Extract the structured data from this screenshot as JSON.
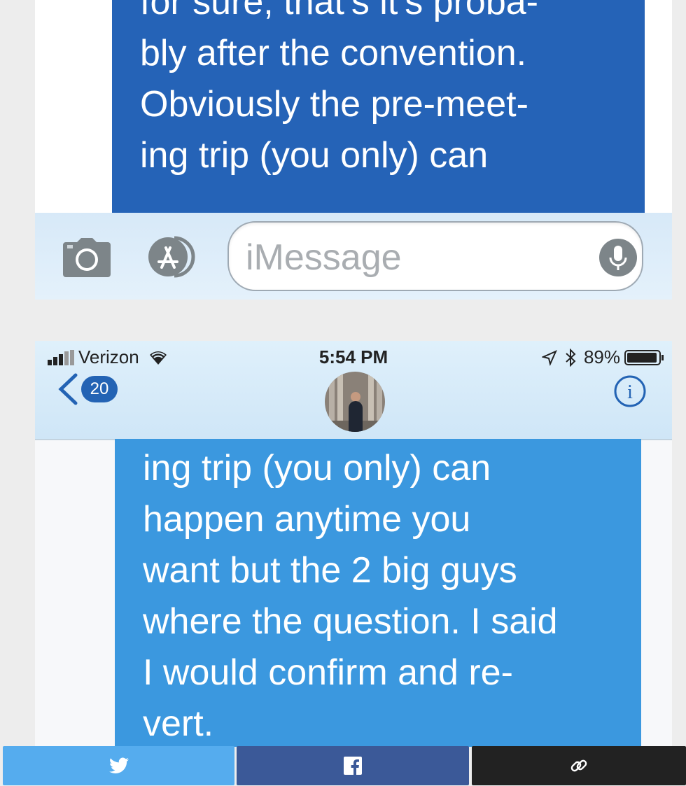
{
  "top_screenshot": {
    "bubble_lines": [
      "for sure, that's it's proba-",
      "bly after the convention.",
      "Obviously the pre-meet-",
      "ing trip (you only) can"
    ],
    "input": {
      "placeholder": "iMessage"
    }
  },
  "bottom_screenshot": {
    "status_bar": {
      "carrier": "Verizon",
      "time": "5:54 PM",
      "battery": "89%"
    },
    "nav": {
      "back_count": "20"
    },
    "bubble_lines": [
      "ing trip (you only) can",
      "happen anytime you",
      "want but the 2 big guys",
      "where the question. I said",
      "I would confirm and re-",
      "vert."
    ]
  },
  "share_bar": {
    "buttons": [
      {
        "icon": "twitter-icon",
        "color": "#55acee"
      },
      {
        "icon": "facebook-icon",
        "color": "#3b5998"
      },
      {
        "icon": "link-icon",
        "color": "#222222"
      }
    ]
  },
  "colors": {
    "top_bubble": "#2563b7",
    "bottom_bubble": "#3b98df",
    "ios_blue": "#2363b4"
  }
}
